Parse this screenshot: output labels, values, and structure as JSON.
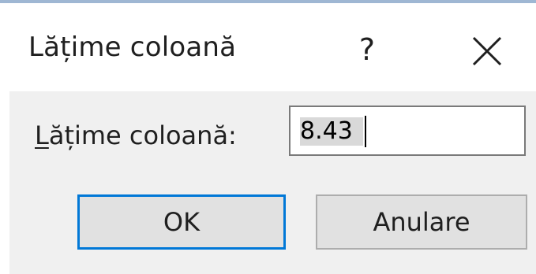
{
  "dialog": {
    "title": "Lățime coloană",
    "help_label": "?",
    "close_icon": "close-icon"
  },
  "form": {
    "label": "ățime coloană:",
    "label_accel": "L",
    "value": "8.43"
  },
  "buttons": {
    "ok": "OK",
    "cancel": "Anulare"
  },
  "colors": {
    "accent": "#0078d7",
    "client_bg": "#f0f0f0",
    "button_bg": "#e1e1e1"
  }
}
